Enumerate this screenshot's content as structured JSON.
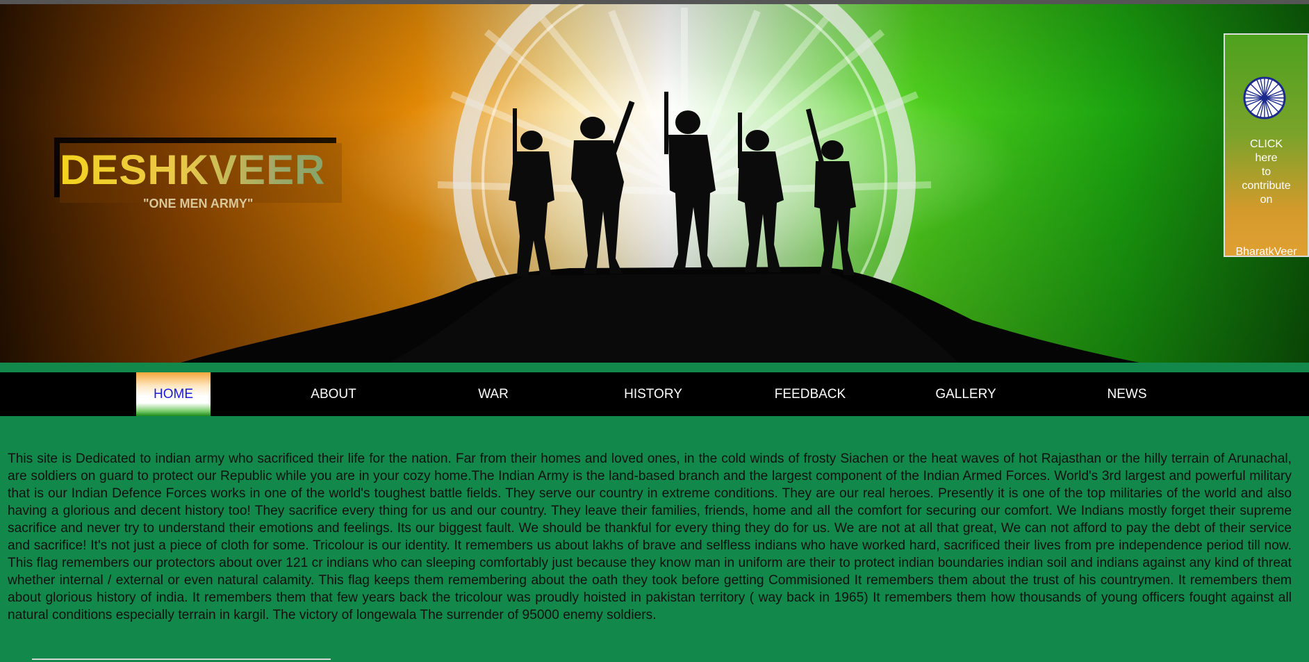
{
  "header": {
    "logo_title": "DESHKVEER",
    "logo_subtitle": "\"ONE MEN ARMY\""
  },
  "contribute_box": {
    "icon": "ashoka-chakra-icon",
    "lines": [
      "CLICK",
      "here",
      "to",
      "contribute",
      "on"
    ],
    "brand": "BharatkVeer"
  },
  "nav": {
    "items": [
      {
        "label": "HOME",
        "active": true
      },
      {
        "label": "ABOUT",
        "active": false
      },
      {
        "label": "WAR",
        "active": false
      },
      {
        "label": "HISTORY",
        "active": false
      },
      {
        "label": "FEEDBACK",
        "active": false
      },
      {
        "label": "GALLERY",
        "active": false
      },
      {
        "label": "NEWS",
        "active": false
      }
    ]
  },
  "main": {
    "paragraph": "This site is Dedicated to indian army who sacrificed their life for the nation. Far from their homes and loved ones, in the cold winds of frosty Siachen or the heat waves of hot Rajasthan or the hilly terrain of Arunachal, are soldiers on guard to protect our Republic while you are in your cozy home.The Indian Army is the land-based branch and the largest component of the Indian Armed Forces. World's 3rd largest and powerful military that is our Indian Defence Forces works in one of the world's toughest battle fields. They serve our country in extreme conditions. They are our real heroes. Presently it is one of the top militaries of the world and also having a glorious and decent history too! They sacrifice every thing for us and our country. They leave their families, friends, home and all the comfort for securing our comfort. We Indians mostly forget their supreme sacrifice and never try to understand their emotions and feelings. Its our biggest fault. We should be thankful for every thing they do for us. We are not at all that great, We can not afford to pay the debt of their service and sacrifice! It's not just a piece of cloth for some. Tricolour is our identity. It remembers us about lakhs of brave and selfless indians who have worked hard, sacrificed their lives from pre independence period till now. This flag remembers our protectors about over 121 cr indians who can sleeping comfortably just because they know man in uniform are their to protect indian boundaries indian soil and indians against any kind of threat whether internal / external or even natural calamity. This flag keeps them remembering about the oath they took before getting Commisioned It remembers them about the trust of his countrymen. It remembers them about glorious history of india. It remembers them that few years back the tricolour was proudly hoisted in pakistan territory ( way back in 1965) It remembers them how thousands of young officers fought against all natural conditions especially terrain in kargil. The victory of longewala The surrender of 95000 enemy soldiers."
  },
  "colors": {
    "page_bg": "#12894a",
    "nav_bg": "#000000",
    "active_text": "#1a1ad8"
  }
}
